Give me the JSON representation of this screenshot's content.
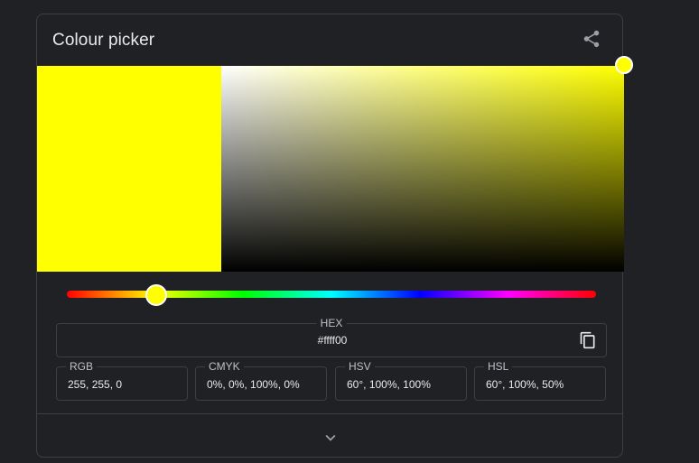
{
  "title": "Colour picker",
  "color": {
    "current": "#ffff00",
    "hue_base": "#ffff00"
  },
  "hue_position": 0.1667,
  "hex": {
    "label": "HEX",
    "value": "#ffff00"
  },
  "fields": [
    {
      "label": "RGB",
      "value": "255, 255, 0"
    },
    {
      "label": "CMYK",
      "value": "0%, 0%, 100%, 0%"
    },
    {
      "label": "HSV",
      "value": "60°, 100%, 100%"
    },
    {
      "label": "HSL",
      "value": "60°, 100%, 50%"
    }
  ],
  "icons": {
    "share": "share-icon",
    "copy": "copy-icon",
    "expand": "chevron-down-icon"
  },
  "colors": {
    "background": "#202124",
    "border": "#3c4043",
    "text": "#e8eaed",
    "muted": "#bdc1c6"
  }
}
